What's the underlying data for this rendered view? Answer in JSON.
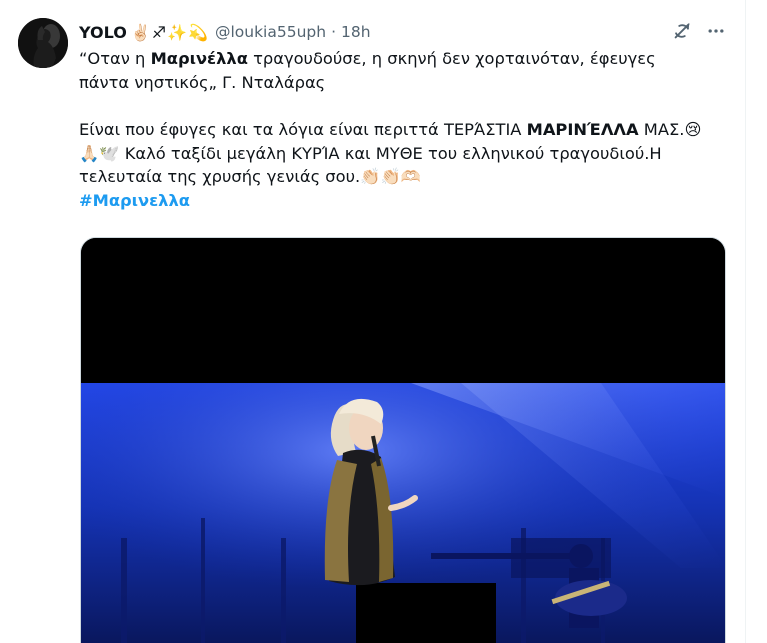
{
  "author": {
    "display_name": "YOLO",
    "badges": "✌🏻♐✨💫",
    "handle": "@loukia55uph",
    "separator": "·",
    "time": "18h",
    "avatar_icon": "avatar-silhouette"
  },
  "actions": {
    "grok_icon": "grok-icon",
    "more_icon": "more-options-icon"
  },
  "tweet": {
    "line1_pre": "“Οταν η ",
    "line1_bold": "Μαρινέλλα",
    "line1_post": " τραγουδούσε, η σκηνή δεν χορταινόταν, έφευγες",
    "line2": "πάντα νηστικός„  Γ. Νταλάρας",
    "line3_pre": "Είναι που έφυγες και τα λόγια είναι περιττά ΤΕΡΆΣΤΙΑ ",
    "line3_bold": "ΜΑΡΙΝΈΛΛΑ",
    "line3_post": " ΜΑΣ.😢",
    "line4": "🙏🏻🕊️  Καλό ταξίδι μεγάλη ΚΥΡΊΑ και ΜΥΘΕ του ελληνικού τραγουδιού.Η",
    "line5": "τελευταία της χρυσής γενιάς σου.👏🏻👏🏻🫶🏻",
    "hashtag": "#Μαρινελλα"
  },
  "media": {
    "type": "video",
    "description_icon": "video-thumbnail"
  },
  "colors": {
    "text": "#0f1419",
    "muted": "#536471",
    "link": "#1d9bf0",
    "stage_blue": "#1a3fd6"
  }
}
